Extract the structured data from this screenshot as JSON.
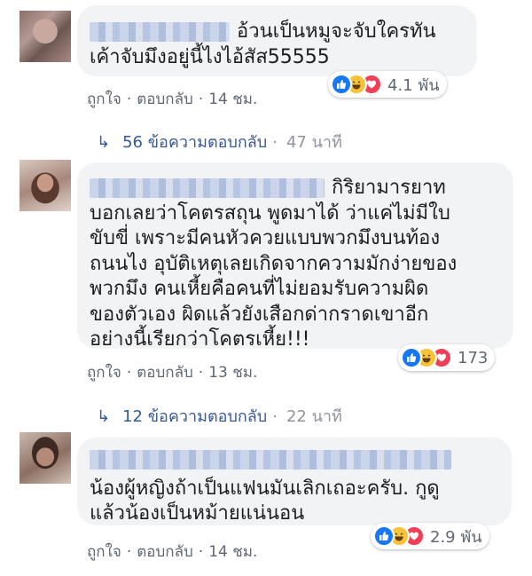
{
  "colors": {
    "link_blue": "#385898",
    "meta_gray": "#606770",
    "bubble_bg": "#f2f3f5",
    "like_blue": "#1877f2",
    "haha_yellow": "#f7c33b",
    "love_red": "#f33e58"
  },
  "comments": [
    {
      "lines": [
        "อ้วนเป็นหมูจะจับใครทัน",
        "เค้าจับมึงอยู่นี้ไงไอ้สัส55555"
      ],
      "actions": {
        "like": "ถูกใจ",
        "reply": "ตอบกลับ",
        "time": "14 ชม."
      },
      "reaction_icons": [
        "like-icon",
        "haha-icon",
        "love-icon"
      ],
      "reaction_count": "4.1 พัน",
      "replies": {
        "text": "56 ข้อความตอบกลับ",
        "time": "47 นาที"
      }
    },
    {
      "lines": [
        "กิริยามารยาท",
        "บอกเลยว่าโคตรสถุน พูดมาได้ ว่าแค่ไม่มีใบ",
        "ขับขี่ เพราะมีคนหัวควยแบบพวกมึงบนท้อง",
        "ถนนไง อุบัติเหตุเลยเกิดจากความมักง่ายของ",
        "พวกมึง คนเหี้ยคือคนที่ไม่ยอมรับความผิด",
        "ของตัวเอง ผิดแล้วยังเสือกด่ากราดเขาอีก",
        "อย่างนี้เรียกว่าโคตรเหี้ย!!!"
      ],
      "actions": {
        "like": "ถูกใจ",
        "reply": "ตอบกลับ",
        "time": "13 ชม."
      },
      "reaction_icons": [
        "like-icon",
        "haha-icon",
        "love-icon"
      ],
      "reaction_count": "173",
      "replies": {
        "text": "12 ข้อความตอบกลับ",
        "time": "22 นาที"
      }
    },
    {
      "lines": [
        "น้องผู้หญิงถ้าเป็นแฟนมันเลิกเถอะครับ. กูดู",
        "แล้วน้องเป็นหม้ายแน่นอน"
      ],
      "actions": {
        "like": "ถูกใจ",
        "reply": "ตอบกลับ",
        "time": "14 ชม."
      },
      "reaction_icons": [
        "like-icon",
        "haha-icon",
        "love-icon"
      ],
      "reaction_count": "2.9 พัน"
    }
  ]
}
